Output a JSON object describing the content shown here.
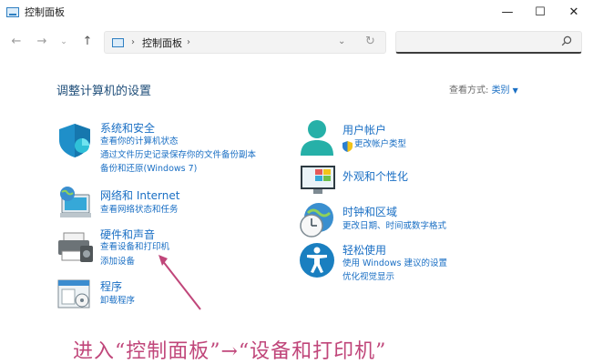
{
  "window": {
    "title": "控制面板",
    "minimize": "—",
    "maximize": "☐",
    "close": "✕"
  },
  "nav": {
    "back": "←",
    "forward": "→",
    "history": "⌄",
    "up": "↑"
  },
  "address": {
    "separator": "›",
    "location": "控制面板",
    "separator_after": "›",
    "dropdown": "⌄",
    "refresh": "↻"
  },
  "search": {
    "value": "",
    "icon_glyph": "⌕"
  },
  "main": {
    "heading": "调整计算机的设置",
    "view_by_label": "查看方式:",
    "view_by_value": "类别",
    "view_by_caret": "▼"
  },
  "categories": {
    "system": {
      "title": "系统和安全",
      "links": [
        "查看你的计算机状态",
        "通过文件历史记录保存你的文件备份副本",
        "备份和还原(Windows 7)"
      ],
      "icon": "shield-icon",
      "color": "#1f8fc9"
    },
    "network": {
      "title": "网络和 Internet",
      "links": [
        "查看网络状态和任务"
      ],
      "icon": "network-globe-icon"
    },
    "hardware": {
      "title": "硬件和声音",
      "links": [
        "查看设备和打印机",
        "添加设备"
      ],
      "icon": "printer-icon"
    },
    "programs": {
      "title": "程序",
      "links": [
        "卸载程序"
      ],
      "icon": "programs-icon"
    },
    "user": {
      "title": "用户帐户",
      "links": [
        "更改帐户类型"
      ],
      "icon": "user-icon",
      "color": "#26b0a8"
    },
    "appearance": {
      "title": "外观和个性化",
      "links": [],
      "icon": "monitor-icon"
    },
    "clock": {
      "title": "时钟和区域",
      "links": [
        "更改日期、时间或数字格式"
      ],
      "icon": "clock-globe-icon"
    },
    "ease": {
      "title": "轻松使用",
      "links": [
        "使用 Windows 建议的设置",
        "优化视觉显示"
      ],
      "icon": "accessibility-icon",
      "color": "#1a7fc0"
    }
  },
  "annotation": {
    "caption": "进入“控制面板”→“设备和打印机”",
    "color": "#c0467a"
  }
}
